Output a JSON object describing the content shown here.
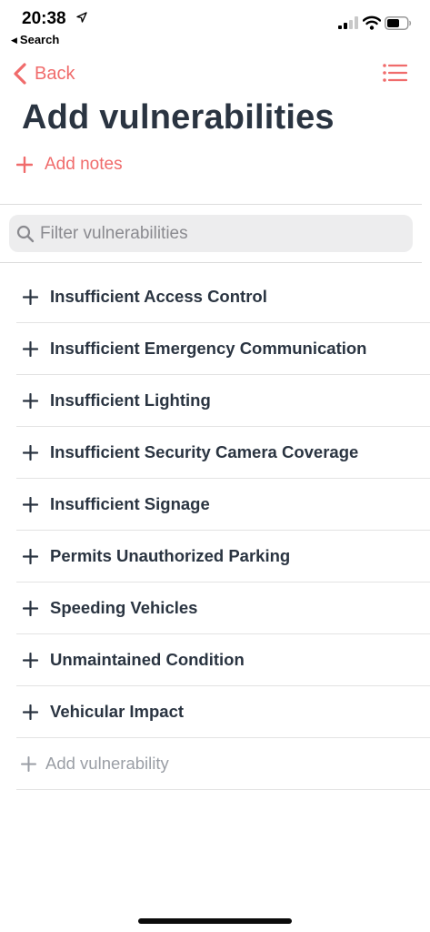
{
  "status_bar": {
    "time": "20:38",
    "back_app": "Search",
    "icons": [
      "location-arrow-icon",
      "signal-icon",
      "wifi-icon",
      "battery-icon"
    ]
  },
  "nav": {
    "back_label": "Back",
    "menu_icon": "list-icon"
  },
  "page": {
    "title": "Add vulnerabilities"
  },
  "notes": {
    "add_label": "Add notes"
  },
  "filter": {
    "placeholder": "Filter vulnerabilities",
    "value": ""
  },
  "vulnerabilities": [
    "Insufficient Access Control",
    "Insufficient Emergency Communication",
    "Insufficient Lighting",
    "Insufficient Security Camera Coverage",
    "Insufficient Signage",
    "Permits Unauthorized Parking",
    "Speeding Vehicles",
    "Unmaintained Condition",
    "Vehicular Impact"
  ],
  "add_vulnerability_label": "Add vulnerability",
  "colors": {
    "accent": "#f06b6b",
    "text": "#2a3441",
    "muted": "#9a9ea5",
    "search_bg": "#ededee"
  }
}
